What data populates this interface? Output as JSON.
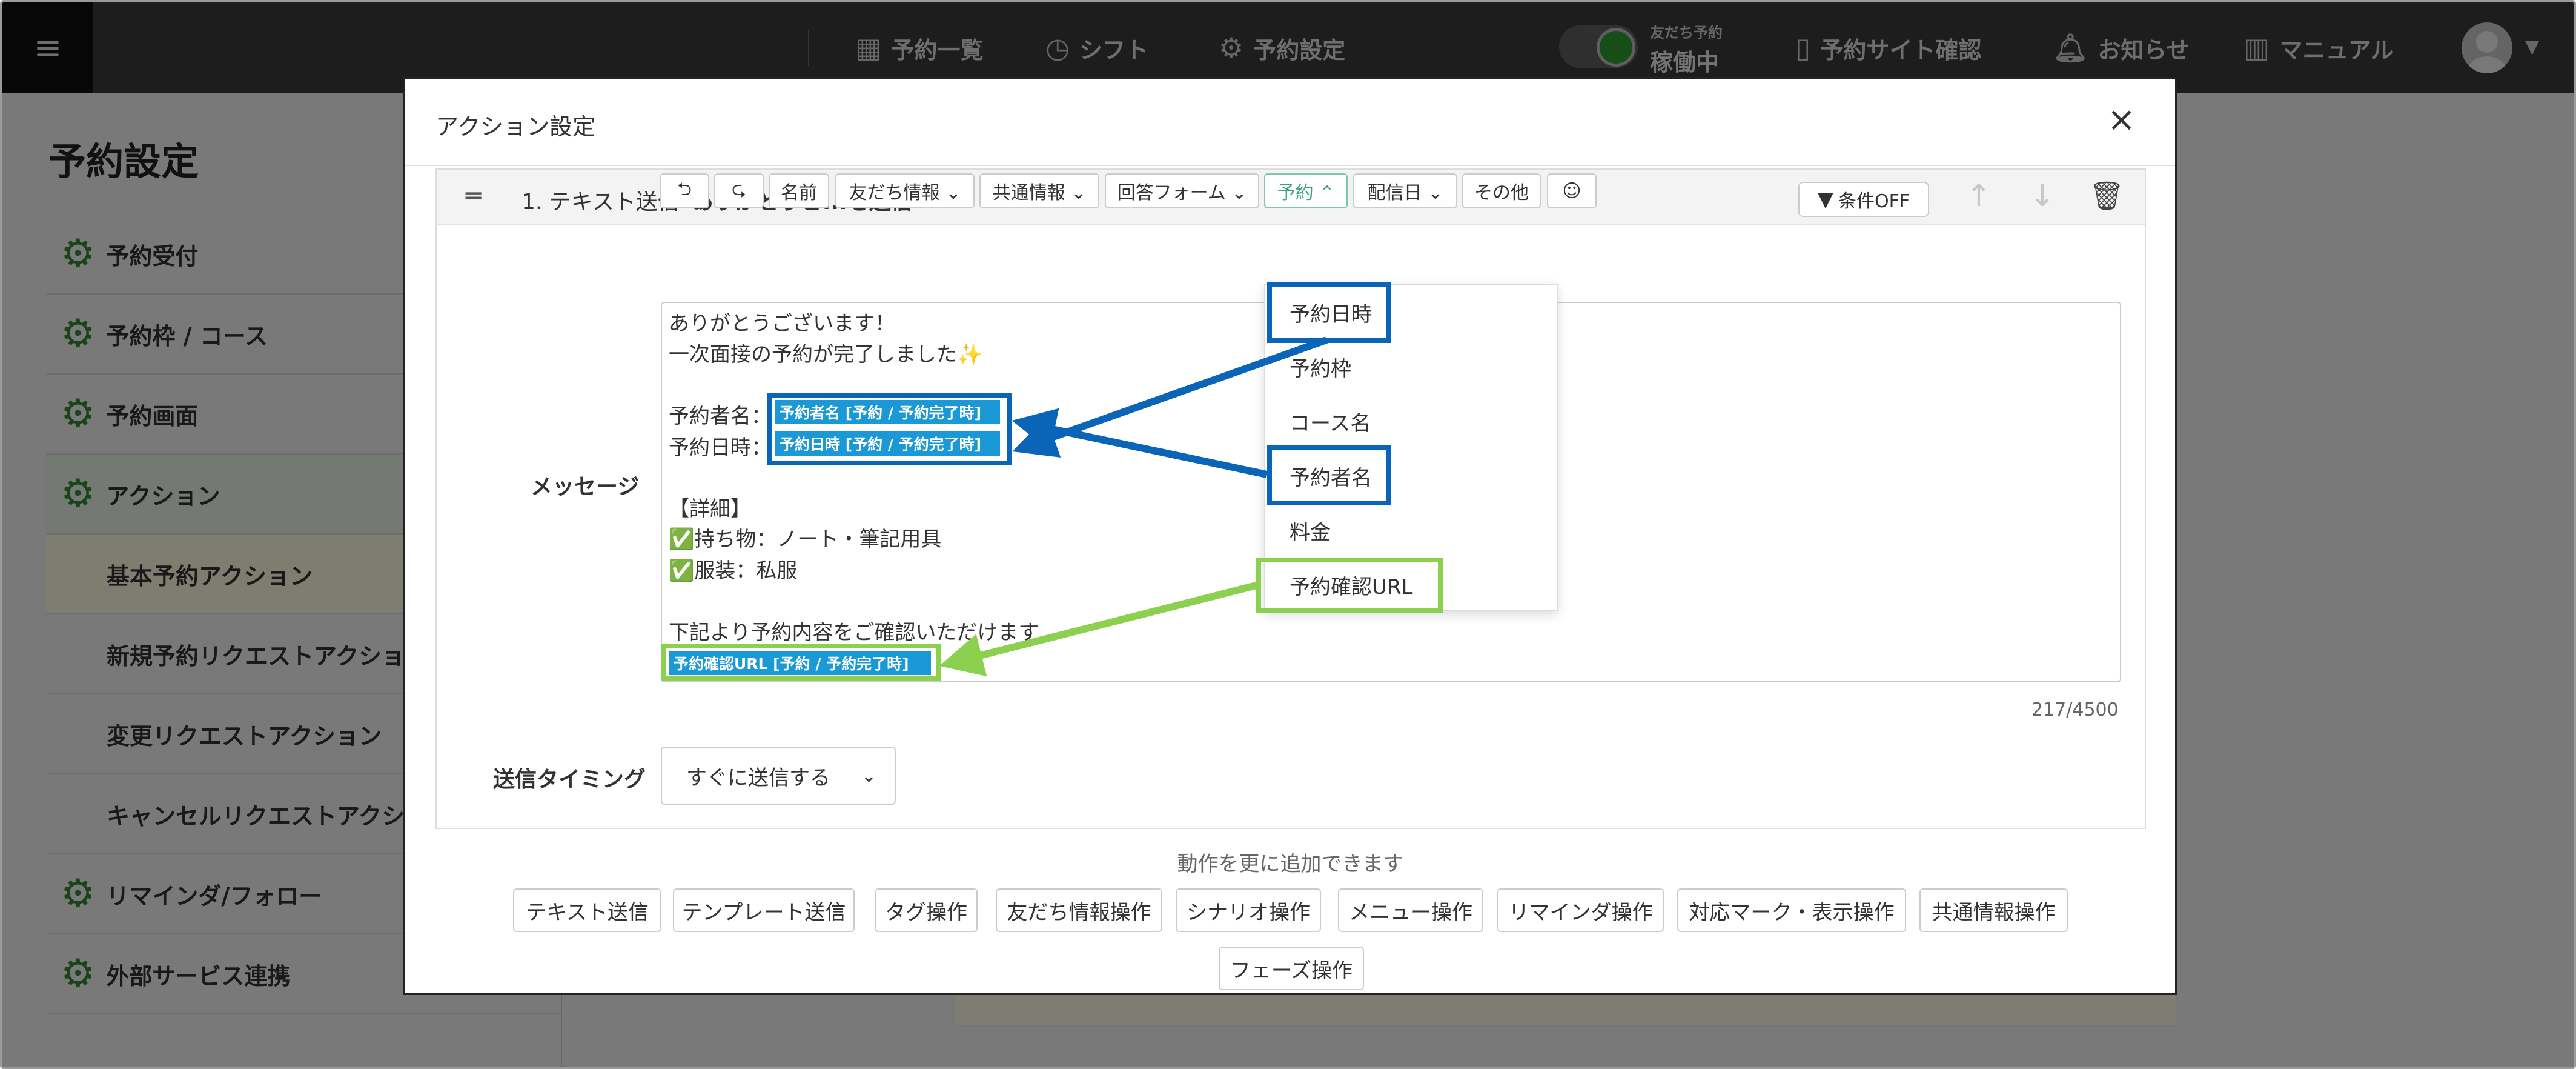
{
  "nav": {
    "menu_icon": "≡",
    "items": [
      {
        "icon": "calendar-icon",
        "glyph": "▦",
        "label": "予約一覧"
      },
      {
        "icon": "clock-icon",
        "glyph": "◷",
        "label": "シフト"
      },
      {
        "icon": "gear-icon",
        "glyph": "⚙",
        "label": "予約設定"
      }
    ],
    "status_small": "友だち予約",
    "status_big": "稼働中",
    "site_check": "予約サイト確認",
    "news": "お知らせ",
    "manual": "マニュアル"
  },
  "page": {
    "title": "予約設定",
    "sidebar": [
      {
        "label": "予約受付"
      },
      {
        "label": "予約枠 / コース"
      },
      {
        "label": "予約画面"
      },
      {
        "label": "アクション"
      },
      {
        "label": "基本予約アクション"
      },
      {
        "label": "新規予約リクエストアクション"
      },
      {
        "label": "変更リクエストアクション"
      },
      {
        "label": "キャンセルリクエストアクション"
      },
      {
        "label": "リマインダ/フォロー"
      },
      {
        "label": "外部サービス連携"
      }
    ]
  },
  "modal": {
    "title": "アクション設定",
    "close": "×",
    "card": {
      "drag": "═",
      "number_type": "1. テキスト送信",
      "name": "ありがとうご...を送信",
      "condition": "条件OFF"
    },
    "toolbar": [
      "⮌",
      "⮎",
      "名前",
      "友だち情報 ⌄",
      "共通情報 ⌄",
      "回答フォーム ⌄",
      "予約 ⌃",
      "配信日 ⌄",
      "その他",
      "☺"
    ],
    "message_label": "メッセージ",
    "message": {
      "line1": "ありがとうございます！",
      "line2": "一次面接の予約が完了しました✨",
      "name_label": "予約者名：",
      "name_tag": "予約者名 [予約 / 予約完了時]",
      "date_label": "予約日時：",
      "date_tag": "予約日時 [予約 / 予約完了時]",
      "detail": "【詳細】",
      "item1": "✅持ち物：ノート・筆記用具",
      "item2": "✅服装：私服",
      "notice": "下記より予約内容をご確認いただけます",
      "url_tag": "予約確認URL [予約 / 予約完了時]"
    },
    "counter": "217/4500",
    "dropdown": [
      "予約日時",
      "予約枠",
      "コース名",
      "予約者名",
      "料金",
      "予約確認URL"
    ],
    "timing_label": "送信タイミング",
    "timing_value": "すぐに送信する",
    "more_text": "動作を更に追加できます",
    "add_buttons": [
      "テキスト送信",
      "テンプレート送信",
      "タグ操作",
      "友だち情報操作",
      "シナリオ操作",
      "メニュー操作",
      "リマインダ操作",
      "対応マーク・表示操作",
      "共通情報操作",
      "フェーズ操作"
    ]
  },
  "colors": {
    "highlight_blue": "#0a64b8",
    "highlight_green": "#8bd14f",
    "tag_blue": "#1a99d6",
    "brand_green": "#2e8b2e"
  }
}
